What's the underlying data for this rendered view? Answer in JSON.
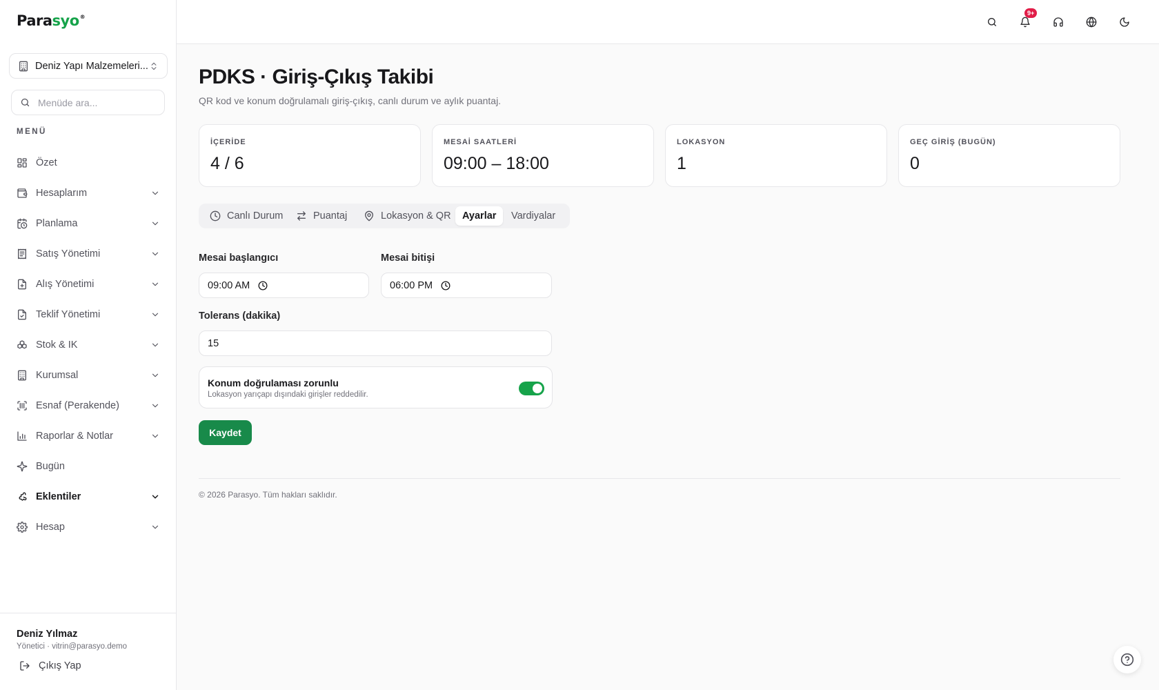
{
  "brand": {
    "name_part1": "Para",
    "name_part2": "syo",
    "reg": "®",
    "accent": "#16a34a"
  },
  "sidebar": {
    "company": "Deniz Yapı Malzemeleri...",
    "search_placeholder": "Menüde ara...",
    "menu_heading": "MENÜ",
    "items": [
      {
        "label": "Özet",
        "icon": "dashboard-icon",
        "expandable": false
      },
      {
        "label": "Hesaplarım",
        "icon": "wallet-icon",
        "expandable": true
      },
      {
        "label": "Planlama",
        "icon": "calendar-clock-icon",
        "expandable": true
      },
      {
        "label": "Satış Yönetimi",
        "icon": "receipt-icon",
        "expandable": true
      },
      {
        "label": "Alış Yönetimi",
        "icon": "file-plus-icon",
        "expandable": true
      },
      {
        "label": "Teklif Yönetimi",
        "icon": "file-check-icon",
        "expandable": true
      },
      {
        "label": "Stok & IK",
        "icon": "boxes-icon",
        "expandable": true
      },
      {
        "label": "Kurumsal",
        "icon": "building-icon",
        "expandable": true
      },
      {
        "label": "Esnaf (Perakende)",
        "icon": "barcode-scan-icon",
        "expandable": true
      },
      {
        "label": "Raporlar & Notlar",
        "icon": "bar-chart-icon",
        "expandable": true
      },
      {
        "label": "Bugün",
        "icon": "sparkles-icon",
        "expandable": false
      },
      {
        "label": "Eklentiler",
        "icon": "puzzle-icon",
        "expandable": true,
        "active": true
      },
      {
        "label": "Hesap",
        "icon": "gear-icon",
        "expandable": true
      }
    ],
    "user": {
      "name": "Deniz Yılmaz",
      "subtitle": "Yönetici · vitrin@parasyo.demo"
    },
    "logout_label": "Çıkış Yap"
  },
  "topbar": {
    "notification_badge": "9+"
  },
  "page": {
    "title": "PDKS · Giriş-Çıkış Takibi",
    "subtitle": "QR kod ve konum doğrulamalı giriş-çıkış, canlı durum ve aylık puantaj."
  },
  "stats": [
    {
      "label": "İÇERİDE",
      "value": "4 / 6"
    },
    {
      "label": "MESAİ SAATLERİ",
      "value": "09:00 – 18:00"
    },
    {
      "label": "LOKASYON",
      "value": "1"
    },
    {
      "label": "GEÇ GİRİŞ (BUGÜN)",
      "value": "0"
    }
  ],
  "tabs": [
    {
      "label": "Canlı Durum",
      "icon": "clock-icon"
    },
    {
      "label": "Puantaj",
      "icon": "arrows-swap-icon"
    },
    {
      "label": "Lokasyon & QR",
      "icon": "map-pin-icon"
    },
    {
      "label": "Ayarlar",
      "active": true
    },
    {
      "label": "Vardiyalar"
    }
  ],
  "form": {
    "start_label": "Mesai başlangıcı",
    "start_value": "09:00 AM",
    "end_label": "Mesai bitişi",
    "end_value": "06:00 PM",
    "tolerance_label": "Tolerans (dakika)",
    "tolerance_value": "15",
    "location_toggle_title": "Konum doğrulaması zorunlu",
    "location_toggle_desc": "Lokasyon yarıçapı dışındaki girişler reddedilir.",
    "location_toggle_on": true,
    "save_label": "Kaydet"
  },
  "footer": "© 2026 Parasyo. Tüm hakları saklıdır."
}
